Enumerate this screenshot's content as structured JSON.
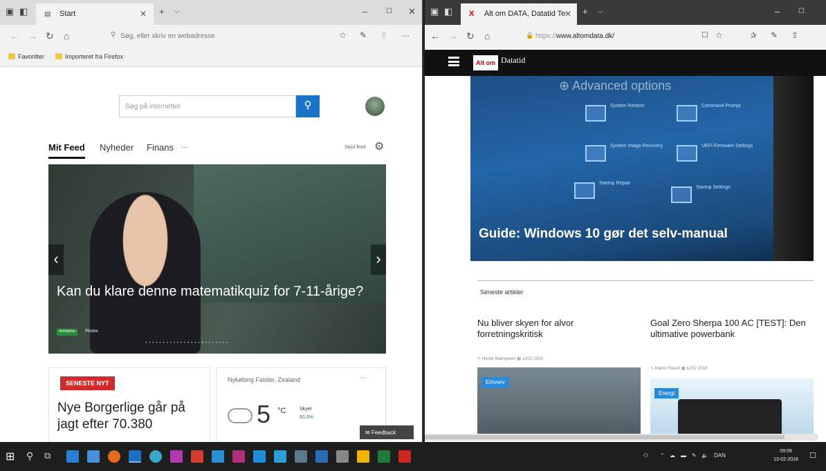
{
  "left_browser": {
    "tab_title": "Start",
    "address_placeholder": "Søg, eller skriv en webadresse",
    "favorites": [
      "Favoritter",
      "Importeret fra Firefox"
    ],
    "search_placeholder": "Søg på internettet",
    "feed_tabs": [
      "Mit Feed",
      "Nyheder",
      "Finans",
      "···"
    ],
    "customize_label": "Skjul feed",
    "hero": {
      "title": "Kan du klare denne matematikquiz for 7-11-årige?",
      "badge": "Annonce",
      "source": "Photos"
    },
    "news_card": {
      "badge": "SENESTE NYT",
      "headline": "Nye Borgerlige går på jagt efter 70.380"
    },
    "weather": {
      "location": "Nykøbing Falster, Zealand",
      "temperature": "5",
      "unit": "°C",
      "condition": "Skyet",
      "precip": "60.0%"
    },
    "feedback_label": "Feedback"
  },
  "right_browser": {
    "tab_title": "Alt om DATA, Datatid Te",
    "url_prefix": "https://",
    "url_host": "www.altomdata.dk/",
    "logo_left": "Alt om DATA",
    "logo_right": "Datatid",
    "feature": {
      "advanced_options": "Advanced options",
      "tiles": [
        "System Restore",
        "Command Prompt",
        "System Image Recovery",
        "UEFI Firmware Settings",
        "Startup Repair",
        "Startup Settings"
      ],
      "title": "Guide: Windows 10 gør det selv-manual"
    },
    "section_label": "Seneste artikler",
    "articles": [
      {
        "title": "Nu bliver skyen for alvor forretningskritisk",
        "author": "Henrik Malmgreen",
        "date": "12/02 2018",
        "tag": "Erhverv",
        "tag_color": "#2a8ad6"
      },
      {
        "title": "Goal Zero Sherpa 100 AC [TEST]: Den ultimative powerbank",
        "author": "Martin Frisenl",
        "date": "12/02 2018",
        "tag": "Energi",
        "tag_color": "#2a8ad6"
      }
    ]
  },
  "taskbar": {
    "language": "DAN",
    "time": "09:09",
    "date": "13-02-2018"
  },
  "colors": {
    "accent_blue": "#1a73c9",
    "news_red": "#d02a2a"
  }
}
